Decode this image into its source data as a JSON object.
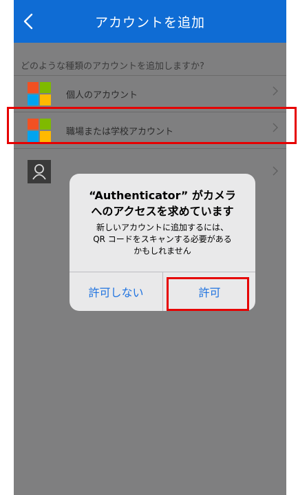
{
  "navbar": {
    "title": "アカウントを追加"
  },
  "section_header": "どのような種類のアカウントを追加しますか?",
  "account_types": [
    {
      "label": "個人のアカウント"
    },
    {
      "label": "職場または学校アカウント"
    }
  ],
  "dialog": {
    "title_line1": "“Authenticator” がカメラ",
    "title_line2": "へのアクセスを求めています",
    "message_line1": "新しいアカウントに追加するには、",
    "message_line2": "QR コードをスキャンする必要がある",
    "message_line3": "かもしれません",
    "deny_label": "許可しない",
    "allow_label": "許可"
  },
  "colors": {
    "navbar": "#0f6cd4",
    "overlay_background": "#7f7f80",
    "dialog_background": "#e9e9ea",
    "button_text": "#1f73e0",
    "highlight": "#e60000"
  },
  "icons": [
    "back-arrow-icon",
    "microsoft-logo-icon",
    "chevron-right-icon",
    "person-icon"
  ]
}
